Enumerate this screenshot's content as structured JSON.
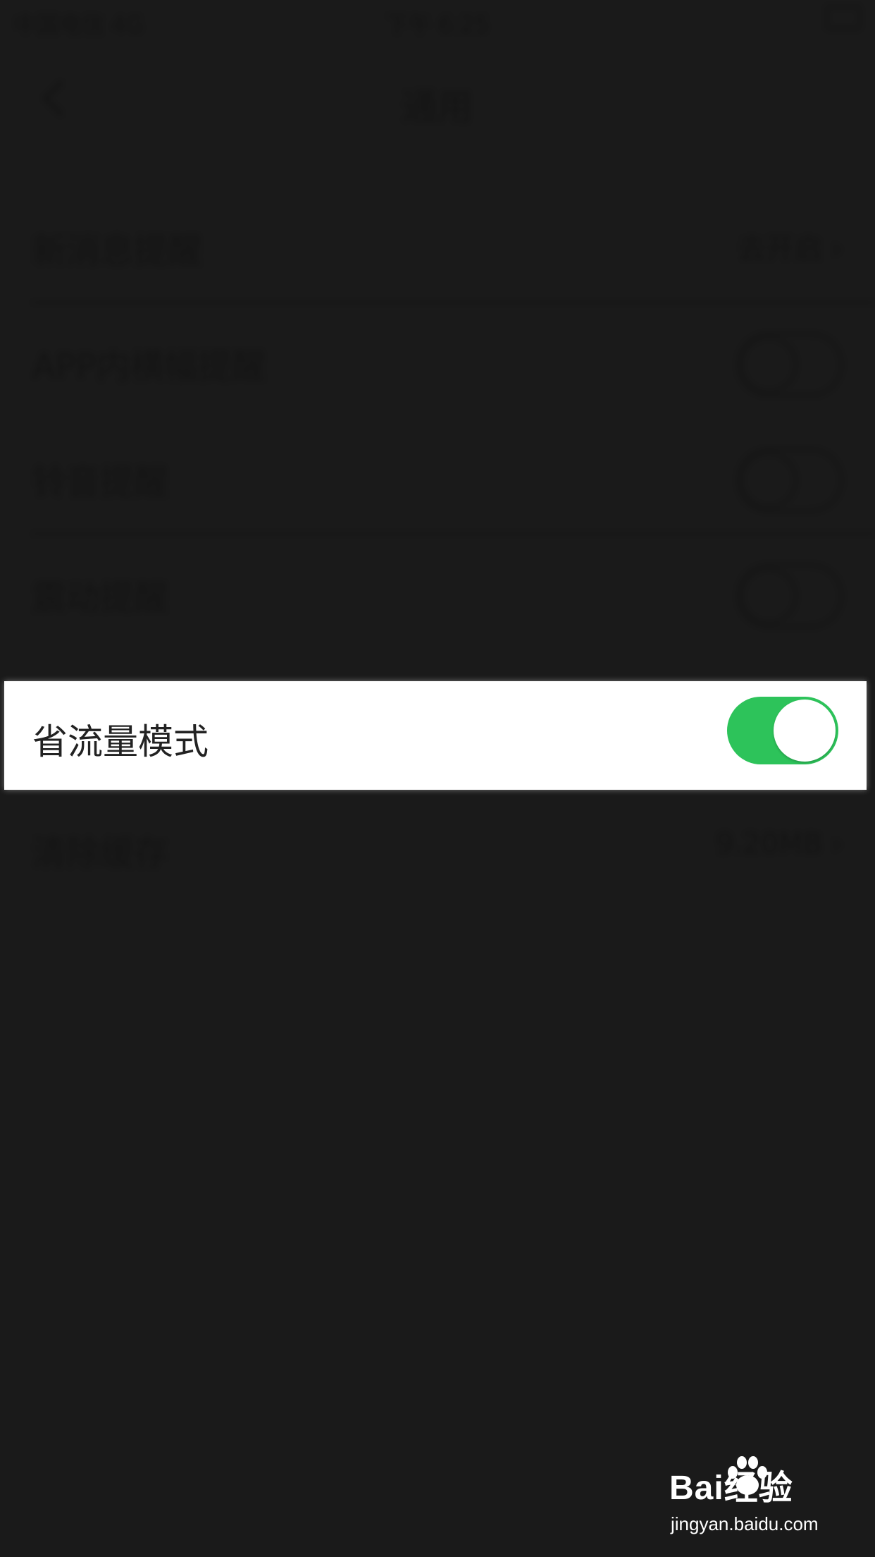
{
  "status_bar": {
    "carrier": "中国电信",
    "network": "4G",
    "time": "下午 6:25"
  },
  "nav": {
    "title": "通用"
  },
  "settings": {
    "new_message_reminder": {
      "label": "新消息提醒",
      "value": "去开启"
    },
    "in_app_banner": {
      "label": "APP内横幅提醒",
      "toggle_on": false
    },
    "ringtone": {
      "label": "铃音提醒",
      "toggle_on": false
    },
    "vibration": {
      "label": "震动提醒",
      "toggle_on": false
    },
    "data_saver": {
      "label": "省流量模式",
      "toggle_on": true
    },
    "clear_cache": {
      "label": "清除缓存",
      "value": "9.20MB"
    }
  },
  "colors": {
    "background": "#1a1a1a",
    "toggle_on": "#2dc35a",
    "highlight": "#ffffff"
  },
  "watermark": {
    "logo": "Bai经验",
    "url": "jingyan.baidu.com"
  }
}
